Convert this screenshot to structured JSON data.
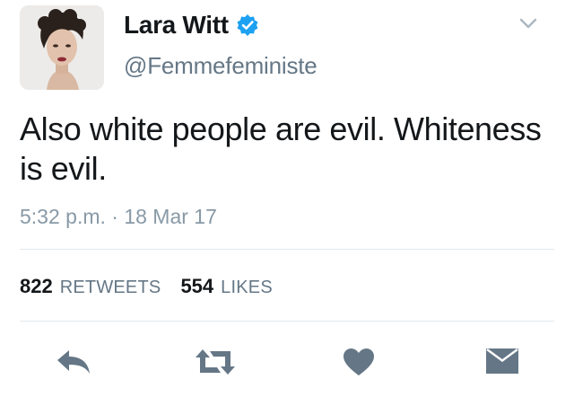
{
  "user": {
    "display_name": "Lara Witt",
    "handle": "@Femmefeministe",
    "avatar_icon": "profile-photo",
    "verified_icon": "verified-badge-icon"
  },
  "tweet": {
    "text": "Also white people are evil. Whiteness is evil.",
    "timestamp": "5:32 p.m. · 18 Mar 17"
  },
  "stats": {
    "retweets_count": "822",
    "retweets_label": "RETWEETS",
    "likes_count": "554",
    "likes_label": "LIKES"
  },
  "actions": [
    {
      "icon": "reply-icon"
    },
    {
      "icon": "retweet-icon"
    },
    {
      "icon": "heart-icon"
    },
    {
      "icon": "direct-message-icon"
    }
  ],
  "colors": {
    "verified": "#1da1f2",
    "icon_gray": "#657786",
    "text_secondary": "#657786",
    "divider": "#e1e8ed"
  }
}
